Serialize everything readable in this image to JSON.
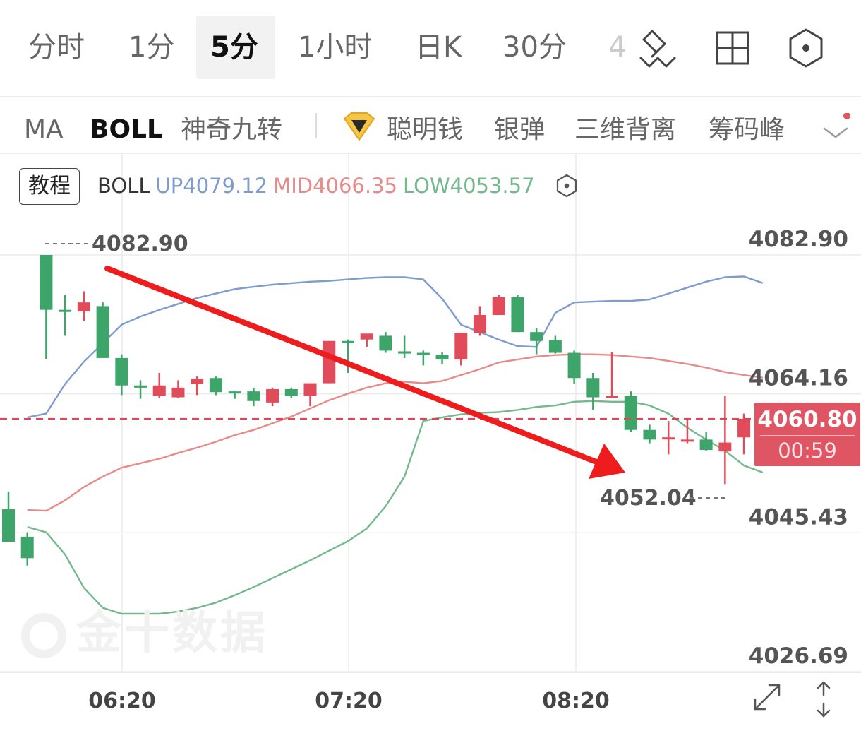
{
  "toolbar": {
    "tabs": [
      {
        "label": "分时"
      },
      {
        "label": "1分"
      },
      {
        "label": "5分"
      },
      {
        "label": "1小时"
      },
      {
        "label": "日K"
      },
      {
        "label": "30分"
      },
      {
        "label": "4"
      }
    ],
    "active_tab": "5分",
    "icons": [
      "draw-tool-icon",
      "grid-layout-icon",
      "settings-hexagon-icon"
    ]
  },
  "indicators": {
    "items": [
      {
        "label": "MA"
      },
      {
        "label": "BOLL"
      },
      {
        "label": "神奇九转"
      },
      {
        "label": "聪明钱"
      },
      {
        "label": "银弹"
      },
      {
        "label": "三维背离"
      },
      {
        "label": "筹码峰"
      }
    ],
    "active": "BOLL",
    "notification_dot_color": "#e05563"
  },
  "legend": {
    "tutorial_label": "教程",
    "name": "BOLL",
    "up": "UP4079.12",
    "mid": "MID4066.35",
    "low": "LOW4053.57",
    "colors": {
      "up": "#7e9ccc",
      "mid": "#e98a8a",
      "low": "#74b98e"
    }
  },
  "price_tag": {
    "price": "4060.80",
    "countdown": "00:59"
  },
  "watermark": "金十数据",
  "chart_data": {
    "type": "candlestick",
    "interval": "5分",
    "y_ticks": [
      "4082.90",
      "4064.16",
      "4045.43",
      "4026.69"
    ],
    "x_ticks": [
      "06:20",
      "07:20",
      "08:20"
    ],
    "ylim": [
      4026.69,
      4082.9
    ],
    "high_marker": "4082.90",
    "low_marker": "4052.04",
    "current_price": 4060.8,
    "up_color": "#e14b5a",
    "down_color": "#3ea56a",
    "candles": [
      {
        "o": 4048.6,
        "h": 4051.0,
        "l": 4045.0,
        "c": 4044.2
      },
      {
        "o": 4044.9,
        "h": 4045.5,
        "l": 4041.0,
        "c": 4042.0
      },
      {
        "o": 4082.9,
        "h": 4082.9,
        "l": 4068.9,
        "c": 4075.5
      },
      {
        "o": 4075.5,
        "h": 4077.5,
        "l": 4072.0,
        "c": 4075.3
      },
      {
        "o": 4075.3,
        "h": 4078.0,
        "l": 4074.0,
        "c": 4076.5
      },
      {
        "o": 4076.0,
        "h": 4076.5,
        "l": 4069.0,
        "c": 4069.0
      },
      {
        "o": 4069.0,
        "h": 4069.5,
        "l": 4064.0,
        "c": 4065.3
      },
      {
        "o": 4065.3,
        "h": 4066.0,
        "l": 4063.5,
        "c": 4065.0
      },
      {
        "o": 4063.9,
        "h": 4067.0,
        "l": 4063.6,
        "c": 4065.3
      },
      {
        "o": 4063.7,
        "h": 4066.0,
        "l": 4063.6,
        "c": 4065.0
      },
      {
        "o": 4065.5,
        "h": 4066.5,
        "l": 4064.0,
        "c": 4066.2
      },
      {
        "o": 4066.3,
        "h": 4066.5,
        "l": 4064.0,
        "c": 4064.4
      },
      {
        "o": 4064.5,
        "h": 4064.5,
        "l": 4063.5,
        "c": 4064.3
      },
      {
        "o": 4064.5,
        "h": 4065.0,
        "l": 4062.5,
        "c": 4063.2
      },
      {
        "o": 4063.0,
        "h": 4065.0,
        "l": 4062.5,
        "c": 4064.8
      },
      {
        "o": 4064.8,
        "h": 4065.0,
        "l": 4063.6,
        "c": 4063.9
      },
      {
        "o": 4063.9,
        "h": 4065.3,
        "l": 4062.5,
        "c": 4065.6
      },
      {
        "o": 4065.6,
        "h": 4071.3,
        "l": 4065.6,
        "c": 4071.3
      },
      {
        "o": 4071.3,
        "h": 4071.5,
        "l": 4067.0,
        "c": 4071.0
      },
      {
        "o": 4071.5,
        "h": 4072.0,
        "l": 4070.5,
        "c": 4072.3
      },
      {
        "o": 4072.0,
        "h": 4072.5,
        "l": 4069.7,
        "c": 4070.0
      },
      {
        "o": 4069.9,
        "h": 4072.0,
        "l": 4069.0,
        "c": 4069.6
      },
      {
        "o": 4069.7,
        "h": 4070.0,
        "l": 4068.0,
        "c": 4069.4
      },
      {
        "o": 4069.4,
        "h": 4069.8,
        "l": 4068.2,
        "c": 4068.8
      },
      {
        "o": 4068.8,
        "h": 4072.3,
        "l": 4068.0,
        "c": 4072.4
      },
      {
        "o": 4072.4,
        "h": 4076.0,
        "l": 4072.0,
        "c": 4074.8
      },
      {
        "o": 4074.8,
        "h": 4077.5,
        "l": 4074.8,
        "c": 4077.2
      },
      {
        "o": 4077.2,
        "h": 4077.5,
        "l": 4072.5,
        "c": 4072.5
      },
      {
        "o": 4072.5,
        "h": 4073.0,
        "l": 4069.5,
        "c": 4071.3
      },
      {
        "o": 4071.4,
        "h": 4072.0,
        "l": 4069.6,
        "c": 4069.7
      },
      {
        "o": 4069.7,
        "h": 4070.0,
        "l": 4065.5,
        "c": 4066.3
      },
      {
        "o": 4066.3,
        "h": 4067.0,
        "l": 4062.0,
        "c": 4063.7
      },
      {
        "o": 4063.9,
        "h": 4069.8,
        "l": 4063.9,
        "c": 4063.9
      },
      {
        "o": 4063.9,
        "h": 4064.5,
        "l": 4059.0,
        "c": 4059.3
      },
      {
        "o": 4059.3,
        "h": 4060.0,
        "l": 4057.5,
        "c": 4058.0
      },
      {
        "o": 4058.3,
        "h": 4060.5,
        "l": 4056.0,
        "c": 4058.3
      },
      {
        "o": 4057.9,
        "h": 4060.7,
        "l": 4057.5,
        "c": 4058.0
      },
      {
        "o": 4058.0,
        "h": 4059.0,
        "l": 4056.5,
        "c": 4056.6
      },
      {
        "o": 4056.4,
        "h": 4063.9,
        "l": 4052.0,
        "c": 4057.6
      },
      {
        "o": 4058.3,
        "h": 4061.5,
        "l": 4056.0,
        "c": 4060.8
      }
    ],
    "boll_up": [
      4061.0,
      4061.5,
      4065.5,
      4068.5,
      4071.0,
      4073.5,
      4074.6,
      4075.5,
      4076.3,
      4077.1,
      4077.7,
      4078.3,
      4078.6,
      4078.9,
      4079.1,
      4079.3,
      4079.4,
      4079.6,
      4079.8,
      4079.9,
      4079.9,
      4079.6,
      4077.0,
      4073.5,
      4072.5,
      4071.5,
      4070.6,
      4070.5,
      4075.1,
      4076.5,
      4076.6,
      4076.7,
      4076.7,
      4076.9,
      4077.7,
      4078.5,
      4079.3,
      4079.9,
      4080.0,
      4079.12
    ],
    "boll_mid": [
      4048.5,
      4048.4,
      4049.8,
      4051.6,
      4053.0,
      4054.2,
      4054.8,
      4055.4,
      4056.2,
      4056.9,
      4057.7,
      4058.6,
      4059.3,
      4060.2,
      4061.1,
      4062.2,
      4063.3,
      4064.2,
      4065.0,
      4065.6,
      4065.8,
      4065.6,
      4065.9,
      4066.7,
      4067.5,
      4068.4,
      4068.8,
      4069.2,
      4069.4,
      4069.5,
      4069.5,
      4069.4,
      4069.2,
      4069.0,
      4068.6,
      4068.2,
      4067.7,
      4067.1,
      4066.7,
      4066.35
    ],
    "boll_low": [
      4046.2,
      4045.5,
      4042.5,
      4038.0,
      4035.3,
      4034.5,
      4034.5,
      4034.5,
      4034.8,
      4035.3,
      4036.0,
      4037.0,
      4038.1,
      4039.3,
      4040.5,
      4041.7,
      4043.0,
      4044.3,
      4046.0,
      4049.0,
      4053.0,
      4060.5,
      4061.0,
      4061.4,
      4061.6,
      4061.7,
      4062.0,
      4062.4,
      4062.6,
      4063.1,
      4063.2,
      4063.1,
      4063.1,
      4062.6,
      4061.5,
      4059.6,
      4058.0,
      4056.5,
      4054.5,
      4053.57
    ]
  }
}
